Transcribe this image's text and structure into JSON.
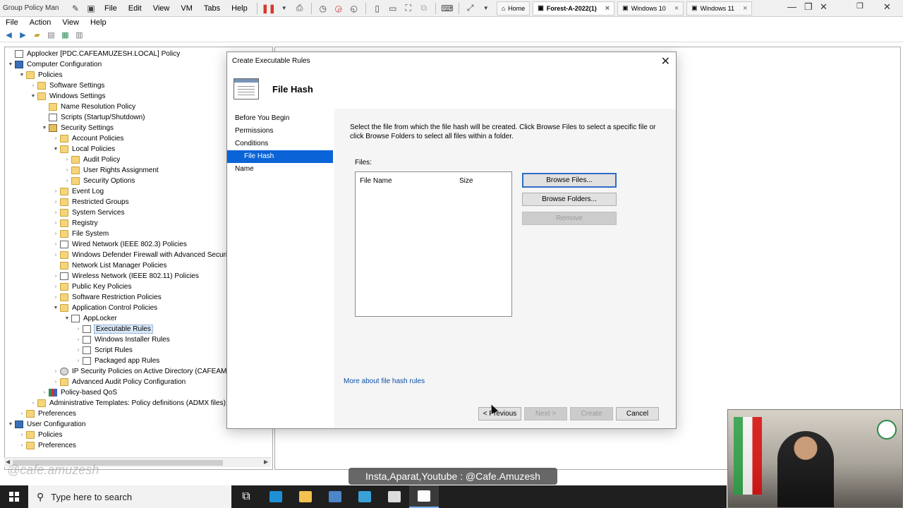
{
  "vm": {
    "title": "Group Policy Man",
    "menu": [
      "File",
      "Edit",
      "View",
      "VM",
      "Tabs",
      "Help"
    ],
    "tabs": [
      {
        "label": "Home",
        "active": false
      },
      {
        "label": "Forest-A-2022(1)",
        "active": true
      },
      {
        "label": "Windows 10",
        "active": false
      },
      {
        "label": "Windows 11",
        "active": false
      }
    ]
  },
  "mmc": {
    "menu": [
      "File",
      "Action",
      "View",
      "Help"
    ]
  },
  "tree": [
    {
      "label": "Applocker [PDC.CAFEAMUZESH.LOCAL] Policy",
      "level": 0,
      "exp": "",
      "icon": "doc"
    },
    {
      "label": "Computer Configuration",
      "level": 0,
      "exp": "▼",
      "icon": "comp"
    },
    {
      "label": "Policies",
      "level": 1,
      "exp": "▼",
      "icon": "folder"
    },
    {
      "label": "Software Settings",
      "level": 2,
      "exp": "›",
      "icon": "folder"
    },
    {
      "label": "Windows Settings",
      "level": 2,
      "exp": "▼",
      "icon": "folder"
    },
    {
      "label": "Name Resolution Policy",
      "level": 3,
      "exp": "",
      "icon": "folder"
    },
    {
      "label": "Scripts (Startup/Shutdown)",
      "level": 3,
      "exp": "",
      "icon": "doc"
    },
    {
      "label": "Security Settings",
      "level": 3,
      "exp": "▼",
      "icon": "lock"
    },
    {
      "label": "Account Policies",
      "level": 4,
      "exp": "›",
      "icon": "folder"
    },
    {
      "label": "Local Policies",
      "level": 4,
      "exp": "▼",
      "icon": "folder"
    },
    {
      "label": "Audit Policy",
      "level": 5,
      "exp": "›",
      "icon": "folder"
    },
    {
      "label": "User Rights Assignment",
      "level": 5,
      "exp": "›",
      "icon": "folder"
    },
    {
      "label": "Security Options",
      "level": 5,
      "exp": "›",
      "icon": "folder"
    },
    {
      "label": "Event Log",
      "level": 4,
      "exp": "›",
      "icon": "folder"
    },
    {
      "label": "Restricted Groups",
      "level": 4,
      "exp": "›",
      "icon": "folder"
    },
    {
      "label": "System Services",
      "level": 4,
      "exp": "›",
      "icon": "folder"
    },
    {
      "label": "Registry",
      "level": 4,
      "exp": "›",
      "icon": "folder"
    },
    {
      "label": "File System",
      "level": 4,
      "exp": "›",
      "icon": "folder"
    },
    {
      "label": "Wired Network (IEEE 802.3) Policies",
      "level": 4,
      "exp": "›",
      "icon": "doc"
    },
    {
      "label": "Windows Defender Firewall with Advanced Security",
      "level": 4,
      "exp": "›",
      "icon": "folder"
    },
    {
      "label": "Network List Manager Policies",
      "level": 4,
      "exp": "",
      "icon": "folder"
    },
    {
      "label": "Wireless Network (IEEE 802.11) Policies",
      "level": 4,
      "exp": "›",
      "icon": "doc"
    },
    {
      "label": "Public Key Policies",
      "level": 4,
      "exp": "›",
      "icon": "folder"
    },
    {
      "label": "Software Restriction Policies",
      "level": 4,
      "exp": "›",
      "icon": "folder"
    },
    {
      "label": "Application Control Policies",
      "level": 4,
      "exp": "▼",
      "icon": "folder"
    },
    {
      "label": "AppLocker",
      "level": 5,
      "exp": "▼",
      "icon": "doc"
    },
    {
      "label": "Executable Rules",
      "level": 6,
      "exp": "›",
      "icon": "doc",
      "selected": true
    },
    {
      "label": "Windows Installer Rules",
      "level": 6,
      "exp": "›",
      "icon": "doc"
    },
    {
      "label": "Script Rules",
      "level": 6,
      "exp": "›",
      "icon": "doc"
    },
    {
      "label": "Packaged app Rules",
      "level": 6,
      "exp": "›",
      "icon": "doc"
    },
    {
      "label": "IP Security Policies on Active Directory (CAFEAMUZ",
      "level": 4,
      "exp": "›",
      "icon": "gear"
    },
    {
      "label": "Advanced Audit Policy Configuration",
      "level": 4,
      "exp": "›",
      "icon": "folder"
    },
    {
      "label": "Policy-based QoS",
      "level": 3,
      "exp": "›",
      "icon": "bar"
    },
    {
      "label": "Administrative Templates: Policy definitions (ADMX files) r",
      "level": 2,
      "exp": "›",
      "icon": "folder"
    },
    {
      "label": "Preferences",
      "level": 1,
      "exp": "›",
      "icon": "folder"
    },
    {
      "label": "User Configuration",
      "level": 0,
      "exp": "▼",
      "icon": "comp"
    },
    {
      "label": "Policies",
      "level": 1,
      "exp": "›",
      "icon": "folder"
    },
    {
      "label": "Preferences",
      "level": 1,
      "exp": "›",
      "icon": "folder"
    }
  ],
  "dialog": {
    "title": "Create Executable Rules",
    "heading": "File Hash",
    "nav": [
      {
        "label": "Before You Begin",
        "sub": false,
        "active": false
      },
      {
        "label": "Permissions",
        "sub": false,
        "active": false
      },
      {
        "label": "Conditions",
        "sub": false,
        "active": false
      },
      {
        "label": "File Hash",
        "sub": true,
        "active": true
      },
      {
        "label": "Name",
        "sub": false,
        "active": false
      }
    ],
    "description": "Select the file from which the file hash will be created. Click Browse Files to select a specific file or click Browse Folders to select all files within a folder.",
    "files_label": "Files:",
    "columns": {
      "name": "File Name",
      "size": "Size"
    },
    "browse_files": "Browse Files...",
    "browse_folders": "Browse Folders...",
    "remove": "Remove",
    "more_link": "More about file hash rules",
    "previous": "< Previous",
    "next": "Next >",
    "create": "Create",
    "cancel": "Cancel"
  },
  "overlay": {
    "watermark": "@cafe.amuzesh",
    "banner": "Insta,Aparat,Youtube : @Cafe.Amuzesh"
  },
  "taskbar": {
    "search_placeholder": "Type here to search",
    "apps": [
      {
        "icon": "task-view-icon",
        "glyph": "⧉",
        "color": "#ffffff"
      },
      {
        "icon": "edge-icon",
        "glyph": "",
        "color": "#1e90d6"
      },
      {
        "icon": "file-explorer-icon",
        "glyph": "",
        "color": "#f2c14e"
      },
      {
        "icon": "server-manager-icon",
        "glyph": "",
        "color": "#4a86c8"
      },
      {
        "icon": "remote-desktop-icon",
        "glyph": "",
        "color": "#3aa0d8"
      },
      {
        "icon": "notepad-icon",
        "glyph": "",
        "color": "#dcdcdc"
      },
      {
        "icon": "notepad-active-icon",
        "glyph": "",
        "color": "#ffffff",
        "active": true
      }
    ]
  }
}
